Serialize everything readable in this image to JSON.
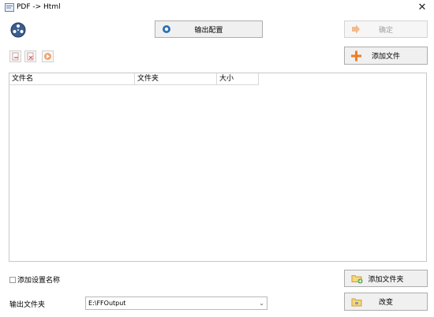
{
  "window": {
    "title": "PDF -> Html",
    "close_glyph": "✕"
  },
  "toolbar": {
    "output_config_label": "输出配置",
    "ok_label": "确定",
    "add_file_label": "添加文件",
    "add_folder_label": "添加文件夹",
    "change_label": "改变"
  },
  "icons": {
    "app": "pdf-app-icon",
    "reel": "film-reel-icon",
    "remove": "remove-file-icon",
    "clear": "clear-list-icon",
    "play": "play-icon",
    "gear": "output-config-icon",
    "arrow": "confirm-arrow-icon",
    "plus": "plus-icon",
    "folder_add": "folder-add-icon",
    "folder": "folder-icon"
  },
  "colors": {
    "accent_orange": "#f07c22",
    "disabled_orange": "#f5b98a"
  },
  "file_list": {
    "columns": [
      "文件名",
      "文件夹",
      "大小"
    ]
  },
  "options": {
    "add_setting_name_label": "添加设置名称"
  },
  "output": {
    "folder_label": "输出文件夹",
    "path": "E:\\FFOutput"
  }
}
